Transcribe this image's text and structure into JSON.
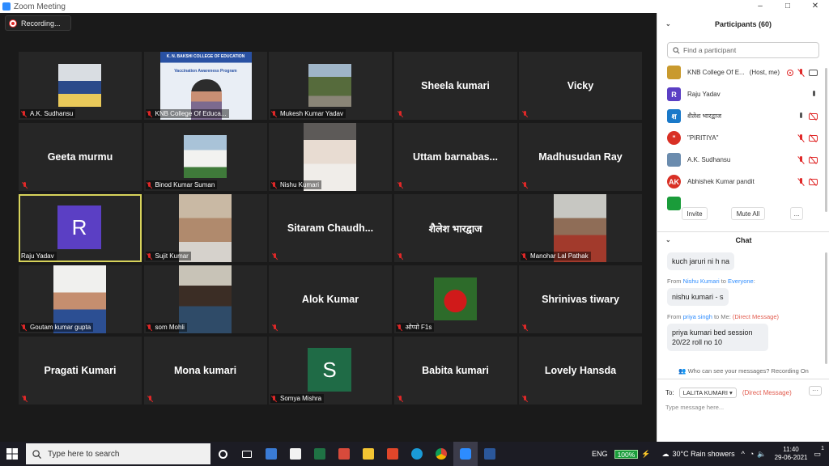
{
  "window": {
    "title": "Zoom Meeting",
    "min": "–",
    "max": "□",
    "close": "✕"
  },
  "recording": {
    "label": "Recording..."
  },
  "tiles": [
    {
      "name": "A.K. Sudhansu",
      "type": "video"
    },
    {
      "name": "KNB College Of Educa...",
      "type": "video"
    },
    {
      "name": "Mukesh Kumar Yadav",
      "type": "video"
    },
    {
      "name": "Sheela kumari",
      "type": "text"
    },
    {
      "name": "Vicky",
      "type": "text"
    },
    {
      "name": "Geeta murmu",
      "type": "text"
    },
    {
      "name": "Binod Kumar Suman",
      "type": "video"
    },
    {
      "name": "Nishu Kumari",
      "type": "video"
    },
    {
      "name": "Uttam barnabas...",
      "type": "text"
    },
    {
      "name": "Madhusudan Ray",
      "type": "text"
    },
    {
      "name": "Raju Yadav",
      "type": "avatar",
      "initial": "R"
    },
    {
      "name": "Sujit Kumar",
      "type": "video"
    },
    {
      "name": "Sitaram Chaudh...",
      "type": "text"
    },
    {
      "name": "शैलेश भारद्वाज",
      "type": "text"
    },
    {
      "name": "Manohar Lal Pathak",
      "type": "video"
    },
    {
      "name": "Goutam kumar gupta",
      "type": "video"
    },
    {
      "name": "som Mohli",
      "type": "video"
    },
    {
      "name": "Alok Kumar",
      "type": "text"
    },
    {
      "name": "ओप्पो F1s",
      "type": "video"
    },
    {
      "name": "Shrinivas tiwary",
      "type": "text"
    },
    {
      "name": "Pragati Kumari",
      "type": "text"
    },
    {
      "name": "Mona kumari",
      "type": "text"
    },
    {
      "name": "Somya Mishra",
      "type": "avatar",
      "initial": "S"
    },
    {
      "name": "Babita kumari",
      "type": "text"
    },
    {
      "name": "Lovely Hansda",
      "type": "text"
    }
  ],
  "knb_banner": {
    "line1": "K. N. BAKSHI COLLEGE OF EDUCATION",
    "line2": "Vaccination Awareness Program"
  },
  "participants": {
    "title": "Participants (60)",
    "search_placeholder": "Find a participant",
    "list": [
      {
        "name": "KNB College Of E...",
        "role": "(Host, me)",
        "initial": "",
        "color": "#c99a2e"
      },
      {
        "name": "Raju Yadav",
        "role": "",
        "initial": "R",
        "color": "#5b3fc4"
      },
      {
        "name": "शैलेश भारद्वाज",
        "role": "",
        "initial": "श",
        "color": "#1a79c9"
      },
      {
        "name": "\"PIRITIYA\"",
        "role": "",
        "initial": "\"",
        "color": "#d93025"
      },
      {
        "name": "A.K. Sudhansu",
        "role": "",
        "initial": "",
        "color": "#6b8cae"
      },
      {
        "name": "Abhishek Kumar pandit",
        "role": "",
        "initial": "AK",
        "color": "#d93025"
      },
      {
        "name": "",
        "role": "",
        "initial": "",
        "color": "#1a9c3a"
      }
    ],
    "invite": "Invite",
    "mute_all": "Mute All",
    "more": "..."
  },
  "chat": {
    "title": "Chat",
    "messages": [
      {
        "from": "",
        "from_name": "",
        "to": "",
        "dm": "",
        "text": "kuch jaruri ni h na"
      },
      {
        "from": "From ",
        "from_name": "Nishu Kumari",
        "to_label": " to ",
        "to": "Everyone",
        "colon": ":",
        "dm": "",
        "text": "nishu kumari - s"
      },
      {
        "from": "From ",
        "from_name": "priya singh",
        "to_label": " to Me: ",
        "to": "",
        "colon": "",
        "dm": "(Direct Message)",
        "text": "priya kumari bed session 20/22 roll no 10"
      }
    ],
    "who_can_see": "Who can see your messages? Recording On",
    "to_label": "To:",
    "recipient": "LALITA KUMARI ▾",
    "direct": "(Direct Message)",
    "more": "···",
    "placeholder": "Type message here..."
  },
  "taskbar": {
    "search": "Type here to search",
    "lang": "ENG",
    "battery": "100%",
    "weather": "30°C  Rain showers",
    "time": "11:40",
    "date": "29-06-2021",
    "notif": "1"
  }
}
